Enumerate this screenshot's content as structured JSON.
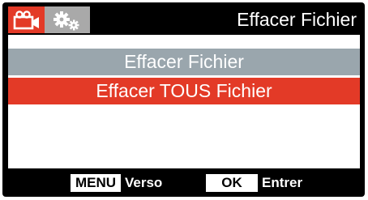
{
  "header": {
    "tabs": [
      {
        "icon": "video-camera-icon",
        "active": true
      },
      {
        "icon": "settings-gears-icon",
        "active": false
      }
    ],
    "title": "Effacer Fichier"
  },
  "menu": {
    "items": [
      {
        "label": "Effacer Fichier",
        "selected": false
      },
      {
        "label": "Effacer TOUS Fichier",
        "selected": true
      }
    ]
  },
  "footer": {
    "menu_key": "MENU",
    "menu_action": "Verso",
    "ok_key": "OK",
    "ok_action": "Entrer"
  },
  "colors": {
    "accent_red": "#e33a27",
    "inactive_gray": "#9aa6ad",
    "tab_gray": "#a9a9a9",
    "background": "#000000"
  }
}
